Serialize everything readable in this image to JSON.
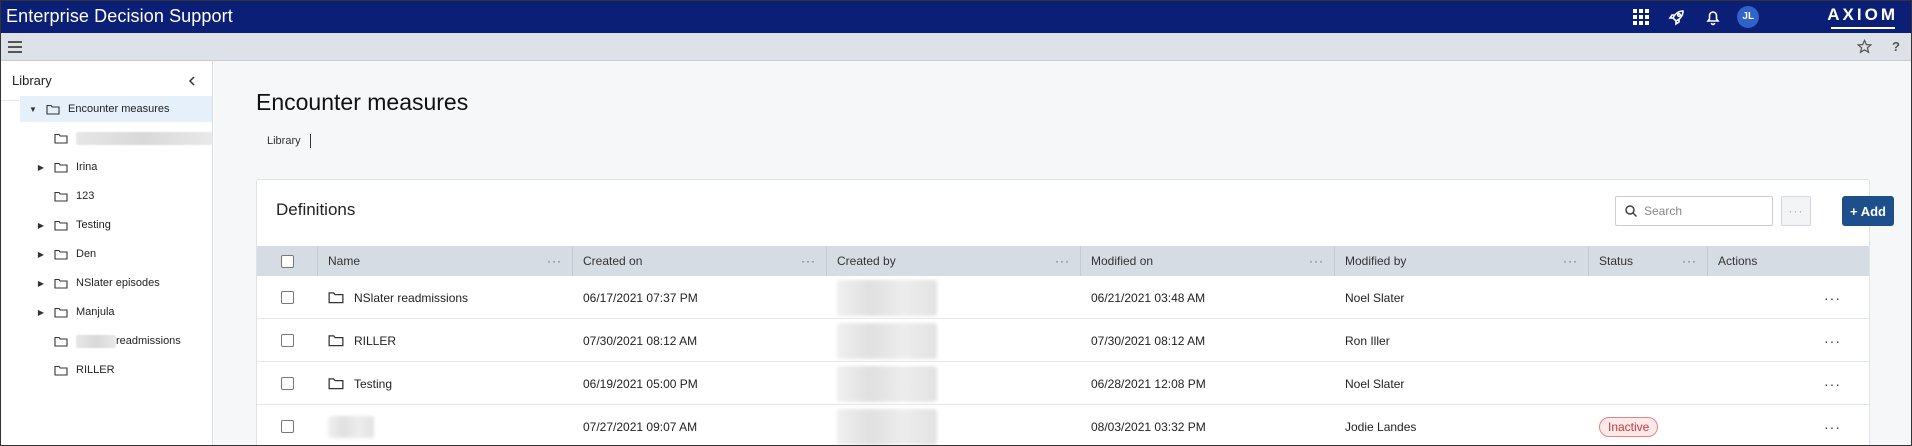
{
  "app": {
    "title": "Enterprise Decision Support",
    "brand": "AXIOM",
    "user_initials": "JL"
  },
  "topbar_icons": [
    "apps-grid-icon",
    "rocket-icon",
    "bell-icon"
  ],
  "subbar_icons": [
    "hamburger-menu-icon",
    "star-icon",
    "help-icon"
  ],
  "sidebar": {
    "title": "Library",
    "items": [
      {
        "label": "Encounter measures",
        "expanded": true,
        "selected": true,
        "has_children": true
      },
      {
        "label": "",
        "redacted": true,
        "has_children": false
      },
      {
        "label": "Irina",
        "has_children": true
      },
      {
        "label": "123",
        "has_children": false
      },
      {
        "label": "Testing",
        "has_children": true
      },
      {
        "label": "Den",
        "has_children": true
      },
      {
        "label": "NSlater episodes",
        "has_children": true
      },
      {
        "label": "Manjula",
        "has_children": true
      },
      {
        "label": "readmissions",
        "prefix_redacted": true,
        "has_children": false
      },
      {
        "label": "RILLER",
        "has_children": false
      }
    ]
  },
  "page": {
    "title": "Encounter measures",
    "breadcrumb": "Library"
  },
  "definitions": {
    "title": "Definitions",
    "search_placeholder": "Search",
    "more_label": "···",
    "add_label": "+ Add",
    "columns": [
      "Name",
      "Created on",
      "Created by",
      "Modified on",
      "Modified by",
      "Status",
      "Actions"
    ],
    "rows": [
      {
        "name": "NSlater readmissions",
        "is_folder": true,
        "created_on": "06/17/2021 07:37 PM",
        "modified_on": "06/21/2021 03:48 AM",
        "modified_by": "Noel Slater",
        "status": ""
      },
      {
        "name": "RILLER",
        "is_folder": true,
        "created_on": "07/30/2021 08:12 AM",
        "modified_on": "07/30/2021 08:12 AM",
        "modified_by": "Ron Iller",
        "status": ""
      },
      {
        "name": "Testing",
        "is_folder": true,
        "created_on": "06/19/2021 05:00 PM",
        "modified_on": "06/28/2021 12:08 PM",
        "modified_by": "Noel Slater",
        "status": ""
      },
      {
        "name": "",
        "is_folder": false,
        "created_on": "07/27/2021 09:07 AM",
        "modified_on": "08/03/2021 03:32 PM",
        "modified_by": "Jodie Landes",
        "status": "Inactive"
      }
    ],
    "actions_label": "···"
  },
  "colors": {
    "topbar": "#0b1f77",
    "accent": "#1d4f8c",
    "inactive": "#c23b3b"
  }
}
